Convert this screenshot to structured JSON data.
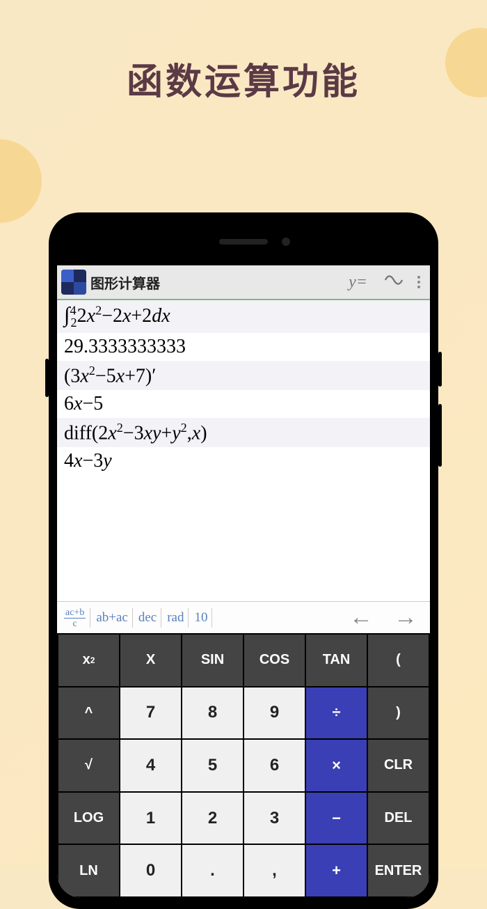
{
  "headline": "函数运算功能",
  "app": {
    "title": "图形计算器",
    "yequals": "y=",
    "menu": "⋮"
  },
  "history": {
    "row0": {
      "upper": "4",
      "lower": "2",
      "body_a": "2",
      "body_b": "−2",
      "body_c": "+2",
      "body_d": "dx",
      "var": "x",
      "exp": "2"
    },
    "row1": "29.3333333333",
    "row2": {
      "open": "(3",
      "v1": "x",
      "e1": "2",
      "mid": "−5",
      "v2": "x",
      "tail": "+7)",
      "prime": "′"
    },
    "row3": {
      "a": "6",
      "v": "x",
      "b": "−5"
    },
    "row4": {
      "fn": "diff(2",
      "v1": "x",
      "e1": "2",
      "m1": "−3",
      "v2": "xy",
      "m2": "+",
      "v3": "y",
      "e3": "2",
      "m3": ",",
      "v4": "x",
      "close": ")"
    },
    "row5": {
      "a": "4",
      "v1": "x",
      "b": "−3",
      "v2": "y"
    }
  },
  "modebar": {
    "frac_num": "ac+b",
    "frac_den": "c",
    "expand": "ab+ac",
    "dec": "dec",
    "rad": "rad",
    "prec": "10",
    "left": "←",
    "right": "→"
  },
  "keys": {
    "r0": [
      "x²",
      "X",
      "SIN",
      "COS",
      "TAN",
      "("
    ],
    "r1": [
      "^",
      "7",
      "8",
      "9",
      "÷",
      ")"
    ],
    "r2": [
      "√",
      "4",
      "5",
      "6",
      "×",
      "CLR"
    ],
    "r3": [
      "LOG",
      "1",
      "2",
      "3",
      "−",
      "DEL"
    ],
    "r4": [
      "LN",
      "0",
      ".",
      ",",
      "+",
      "ENTER"
    ]
  }
}
